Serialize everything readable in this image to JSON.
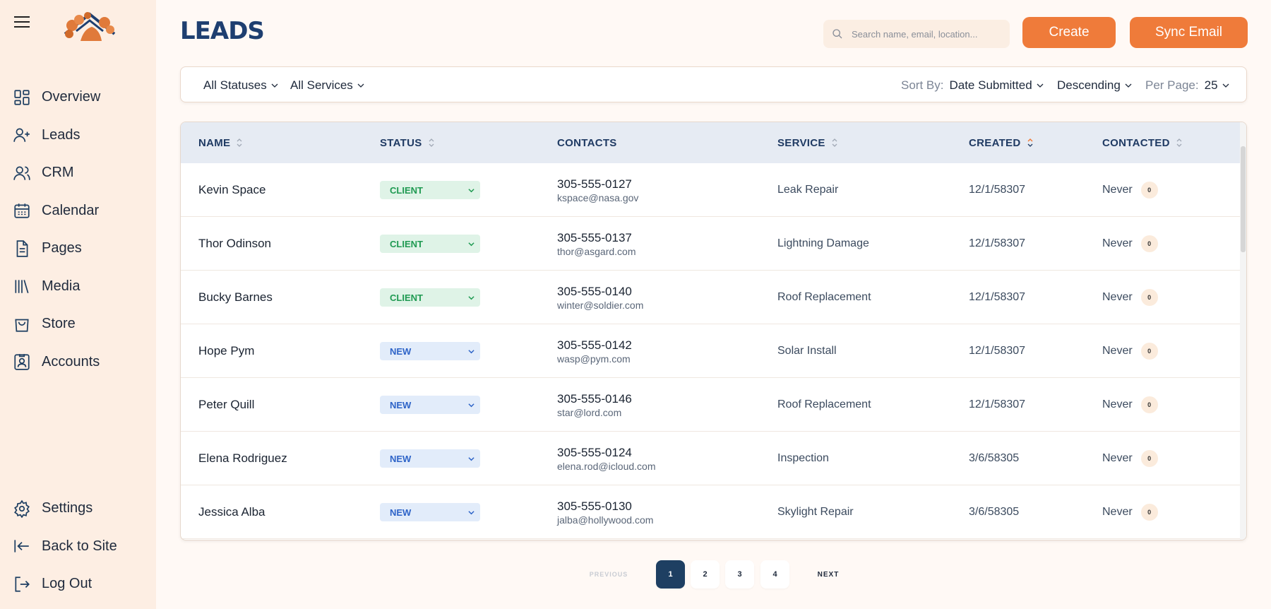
{
  "header": {
    "title": "LEADS",
    "search_placeholder": "Search name, email, location...",
    "create_label": "Create",
    "sync_label": "Sync Email"
  },
  "sidebar": {
    "items": [
      {
        "label": "Overview",
        "icon": "grid-icon"
      },
      {
        "label": "Leads",
        "icon": "user-plus-icon"
      },
      {
        "label": "CRM",
        "icon": "users-icon"
      },
      {
        "label": "Calendar",
        "icon": "calendar-icon"
      },
      {
        "label": "Pages",
        "icon": "document-icon"
      },
      {
        "label": "Media",
        "icon": "library-icon"
      },
      {
        "label": "Store",
        "icon": "shopping-bag-icon"
      },
      {
        "label": "Accounts",
        "icon": "contact-card-icon"
      }
    ],
    "bottom": [
      {
        "label": "Settings",
        "icon": "gear-icon"
      },
      {
        "label": "Back to Site",
        "icon": "arrow-left-bar-icon"
      },
      {
        "label": "Log Out",
        "icon": "logout-icon"
      }
    ]
  },
  "filters": {
    "status": "All Statuses",
    "services": "All Services",
    "sort_label": "Sort By:",
    "sort_value": "Date Submitted",
    "order": "Descending",
    "per_page_label": "Per Page:",
    "per_page_value": "25"
  },
  "table": {
    "columns": [
      "NAME",
      "STATUS",
      "CONTACTS",
      "SERVICE",
      "CREATED",
      "CONTACTED"
    ],
    "rows": [
      {
        "name": "Kevin Space",
        "status": "CLIENT",
        "phone": "305-555-0127",
        "email": "kspace@nasa.gov",
        "service": "Leak Repair",
        "created": "12/1/58307",
        "contacted": "Never",
        "count": "0"
      },
      {
        "name": "Thor Odinson",
        "status": "CLIENT",
        "phone": "305-555-0137",
        "email": "thor@asgard.com",
        "service": "Lightning Damage",
        "created": "12/1/58307",
        "contacted": "Never",
        "count": "0"
      },
      {
        "name": "Bucky Barnes",
        "status": "CLIENT",
        "phone": "305-555-0140",
        "email": "winter@soldier.com",
        "service": "Roof Replacement",
        "created": "12/1/58307",
        "contacted": "Never",
        "count": "0"
      },
      {
        "name": "Hope Pym",
        "status": "NEW",
        "phone": "305-555-0142",
        "email": "wasp@pym.com",
        "service": "Solar Install",
        "created": "12/1/58307",
        "contacted": "Never",
        "count": "0"
      },
      {
        "name": "Peter Quill",
        "status": "NEW",
        "phone": "305-555-0146",
        "email": "star@lord.com",
        "service": "Roof Replacement",
        "created": "12/1/58307",
        "contacted": "Never",
        "count": "0"
      },
      {
        "name": "Elena Rodriguez",
        "status": "NEW",
        "phone": "305-555-0124",
        "email": "elena.rod@icloud.com",
        "service": "Inspection",
        "created": "3/6/58305",
        "contacted": "Never",
        "count": "0"
      },
      {
        "name": "Jessica Alba",
        "status": "NEW",
        "phone": "305-555-0130",
        "email": "jalba@hollywood.com",
        "service": "Skylight Repair",
        "created": "3/6/58305",
        "contacted": "Never",
        "count": "0"
      }
    ]
  },
  "pagination": {
    "previous": "PREVIOUS",
    "next": "NEXT",
    "pages": [
      "1",
      "2",
      "3",
      "4"
    ],
    "current": "1"
  },
  "colors": {
    "accent": "#ef7b3a",
    "navy": "#1e3f70",
    "client_bg": "#dff3e7",
    "client_fg": "#1f9a52",
    "new_bg": "#e2ecfa",
    "new_fg": "#2e64c8",
    "sidebar_bg": "#fdeee3"
  }
}
